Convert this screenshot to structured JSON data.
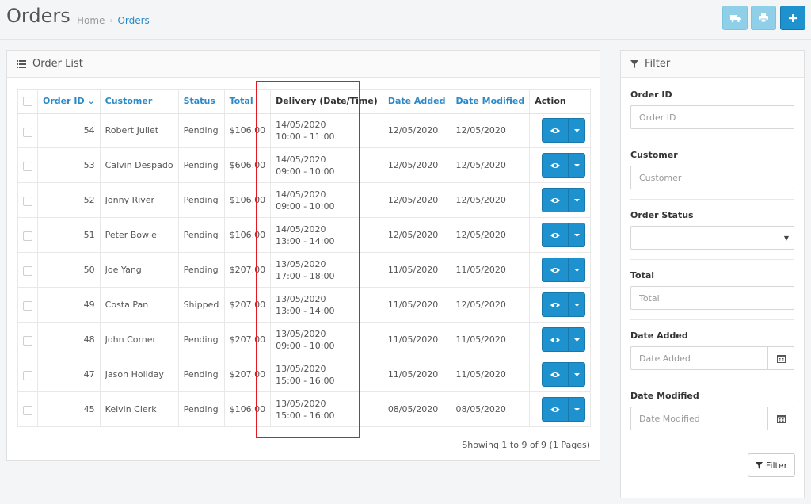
{
  "header": {
    "title": "Orders",
    "breadcrumb": {
      "home": "Home",
      "separator": "›",
      "current": "Orders"
    },
    "buttons": [
      {
        "icon": "truck-icon",
        "style": "light"
      },
      {
        "icon": "print-icon",
        "style": "light"
      },
      {
        "icon": "plus-icon",
        "style": "primary"
      }
    ]
  },
  "order_list": {
    "title": "Order List",
    "columns": {
      "order_id": "Order ID",
      "customer": "Customer",
      "status": "Status",
      "total": "Total",
      "delivery": "Delivery (Date/Time)",
      "date_added": "Date Added",
      "date_modified": "Date Modified",
      "action": "Action"
    },
    "sort_indicator": "⌄",
    "rows": [
      {
        "id": "54",
        "customer": "Robert Juliet",
        "status": "Pending",
        "total": "$106.00",
        "delivery_date": "14/05/2020",
        "delivery_time": "10:00 - 11:00",
        "date_added": "12/05/2020",
        "date_modified": "12/05/2020"
      },
      {
        "id": "53",
        "customer": "Calvin Despado",
        "status": "Pending",
        "total": "$606.00",
        "delivery_date": "14/05/2020",
        "delivery_time": "09:00 - 10:00",
        "date_added": "12/05/2020",
        "date_modified": "12/05/2020"
      },
      {
        "id": "52",
        "customer": "Jonny River",
        "status": "Pending",
        "total": "$106.00",
        "delivery_date": "14/05/2020",
        "delivery_time": "09:00 - 10:00",
        "date_added": "12/05/2020",
        "date_modified": "12/05/2020"
      },
      {
        "id": "51",
        "customer": "Peter Bowie",
        "status": "Pending",
        "total": "$106.00",
        "delivery_date": "14/05/2020",
        "delivery_time": "13:00 - 14:00",
        "date_added": "12/05/2020",
        "date_modified": "12/05/2020"
      },
      {
        "id": "50",
        "customer": "Joe Yang",
        "status": "Pending",
        "total": "$207.00",
        "delivery_date": "13/05/2020",
        "delivery_time": "17:00 - 18:00",
        "date_added": "11/05/2020",
        "date_modified": "11/05/2020"
      },
      {
        "id": "49",
        "customer": "Costa Pan",
        "status": "Shipped",
        "total": "$207.00",
        "delivery_date": "13/05/2020",
        "delivery_time": "13:00 - 14:00",
        "date_added": "11/05/2020",
        "date_modified": "12/05/2020"
      },
      {
        "id": "48",
        "customer": "John Corner",
        "status": "Pending",
        "total": "$207.00",
        "delivery_date": "13/05/2020",
        "delivery_time": "09:00 - 10:00",
        "date_added": "11/05/2020",
        "date_modified": "11/05/2020"
      },
      {
        "id": "47",
        "customer": "Jason Holiday",
        "status": "Pending",
        "total": "$207.00",
        "delivery_date": "13/05/2020",
        "delivery_time": "15:00 - 16:00",
        "date_added": "11/05/2020",
        "date_modified": "11/05/2020"
      },
      {
        "id": "45",
        "customer": "Kelvin Clerk",
        "status": "Pending",
        "total": "$106.00",
        "delivery_date": "13/05/2020",
        "delivery_time": "15:00 - 16:00",
        "date_added": "08/05/2020",
        "date_modified": "08/05/2020"
      }
    ],
    "pagination": "Showing 1 to 9 of 9 (1 Pages)"
  },
  "filter": {
    "title": "Filter",
    "order_id": {
      "label": "Order ID",
      "placeholder": "Order ID",
      "value": ""
    },
    "customer": {
      "label": "Customer",
      "placeholder": "Customer",
      "value": ""
    },
    "order_status": {
      "label": "Order Status",
      "value": ""
    },
    "total": {
      "label": "Total",
      "placeholder": "Total",
      "value": ""
    },
    "date_added": {
      "label": "Date Added",
      "placeholder": "Date Added",
      "value": ""
    },
    "date_modified": {
      "label": "Date Modified",
      "placeholder": "Date Modified",
      "value": ""
    },
    "button_label": "Filter"
  },
  "colors": {
    "primary": "#1e91cf",
    "link": "#2a8ac8",
    "highlight": "#e11b22"
  }
}
